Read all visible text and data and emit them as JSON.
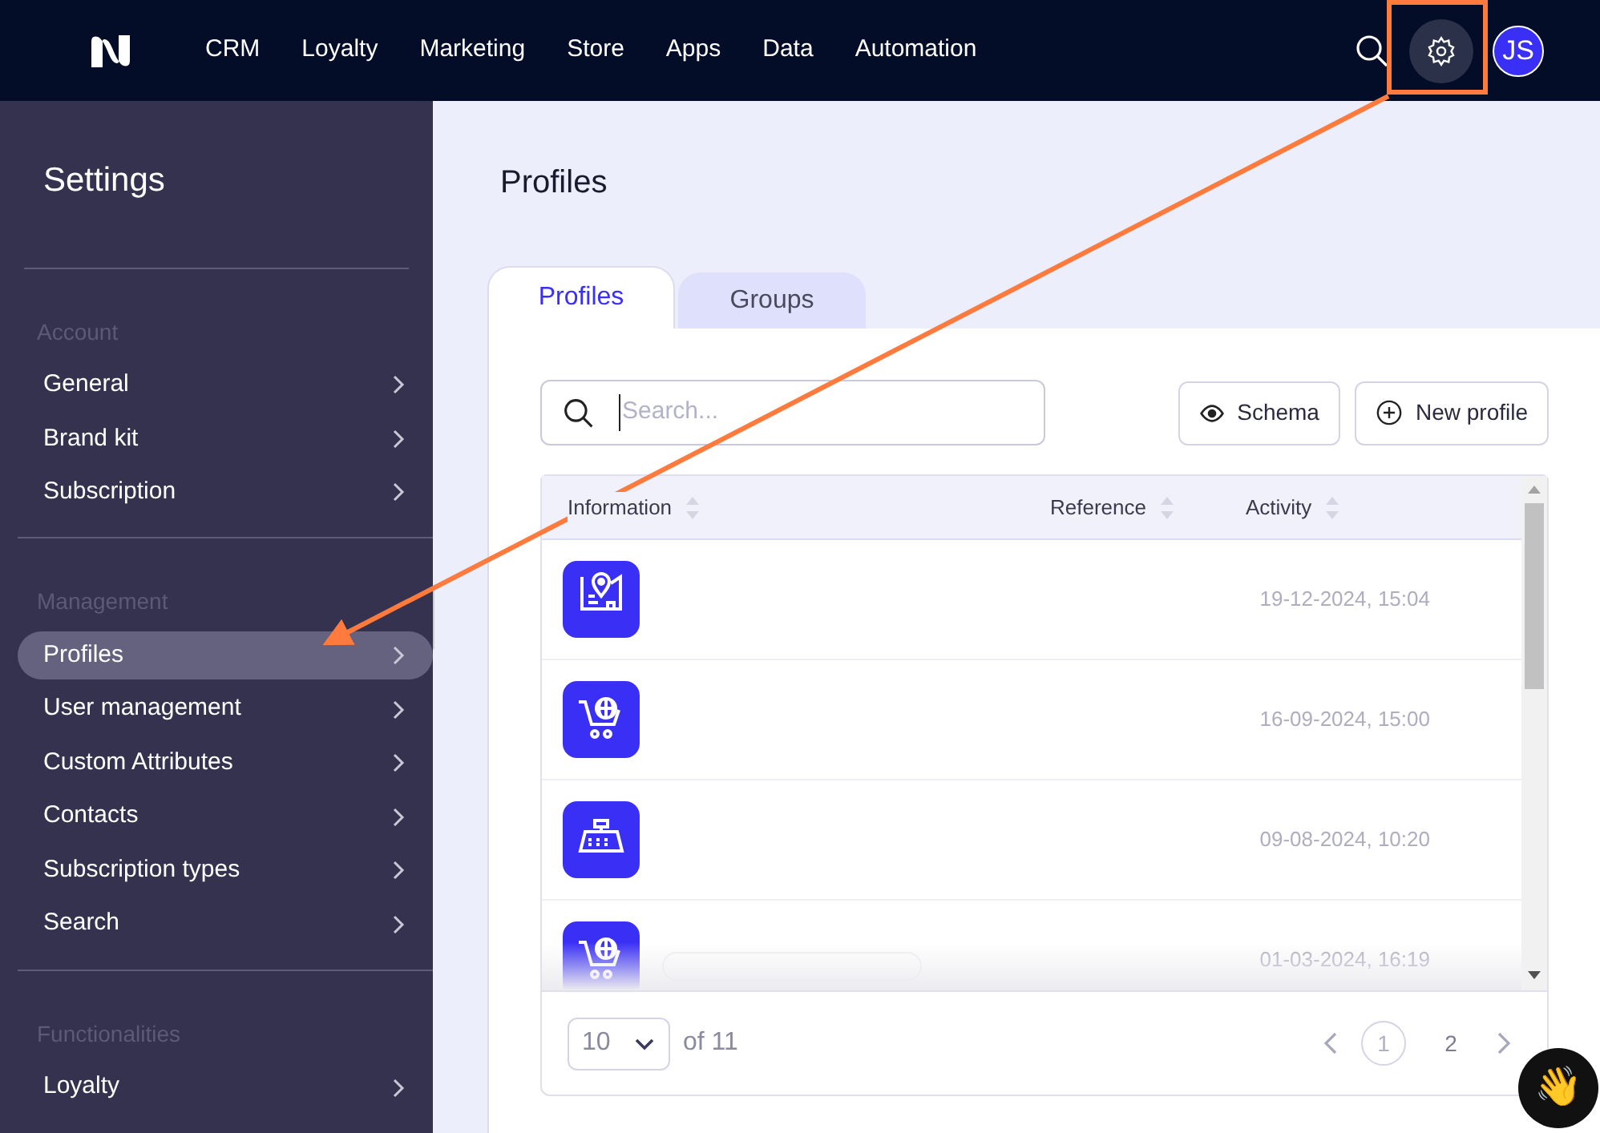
{
  "topbar": {
    "nav": [
      {
        "label": "CRM"
      },
      {
        "label": "Loyalty"
      },
      {
        "label": "Marketing"
      },
      {
        "label": "Store"
      },
      {
        "label": "Apps"
      },
      {
        "label": "Data"
      },
      {
        "label": "Automation"
      }
    ],
    "avatar": "JS"
  },
  "sidebar": {
    "title": "Settings",
    "sections": [
      {
        "heading": "Account",
        "items": [
          {
            "label": "General",
            "selected": false
          },
          {
            "label": "Brand kit",
            "selected": false
          },
          {
            "label": "Subscription",
            "selected": false
          }
        ]
      },
      {
        "heading": "Management",
        "items": [
          {
            "label": "Profiles",
            "selected": true
          },
          {
            "label": "User management",
            "selected": false
          },
          {
            "label": "Custom Attributes",
            "selected": false
          },
          {
            "label": "Contacts",
            "selected": false
          },
          {
            "label": "Subscription types",
            "selected": false
          },
          {
            "label": "Search",
            "selected": false
          }
        ]
      },
      {
        "heading": "Functionalities",
        "items": [
          {
            "label": "Loyalty",
            "selected": false
          }
        ]
      }
    ]
  },
  "page": {
    "title": "Profiles"
  },
  "tabs": [
    {
      "label": "Profiles",
      "selected": true
    },
    {
      "label": "Groups",
      "selected": false
    }
  ],
  "search": {
    "placeholder": "Search..."
  },
  "buttons": [
    {
      "kind": "view",
      "label": "Schema"
    },
    {
      "kind": "add",
      "label": "New profile"
    }
  ],
  "table": {
    "columns": [
      {
        "label": "Information"
      },
      {
        "label": "Reference"
      },
      {
        "label": "Activity"
      }
    ],
    "rows": [
      {
        "kind": "map",
        "activity": "19-12-2024, 15:04",
        "redacted": false
      },
      {
        "kind": "cart",
        "activity": "16-09-2024, 15:00",
        "redacted": false
      },
      {
        "kind": "register",
        "activity": "09-08-2024, 10:20",
        "redacted": false
      },
      {
        "kind": "cart",
        "activity": "01-03-2024, 16:19",
        "redacted": true
      }
    ]
  },
  "pagination": {
    "page_size": "10",
    "total": "of 11",
    "pages": [
      {
        "label": "1",
        "selected": true
      },
      {
        "label": "2",
        "selected": false
      }
    ]
  },
  "chat_button": {
    "emoji": "👋"
  },
  "annotation": {
    "highlight_box": true,
    "arrow": true
  }
}
